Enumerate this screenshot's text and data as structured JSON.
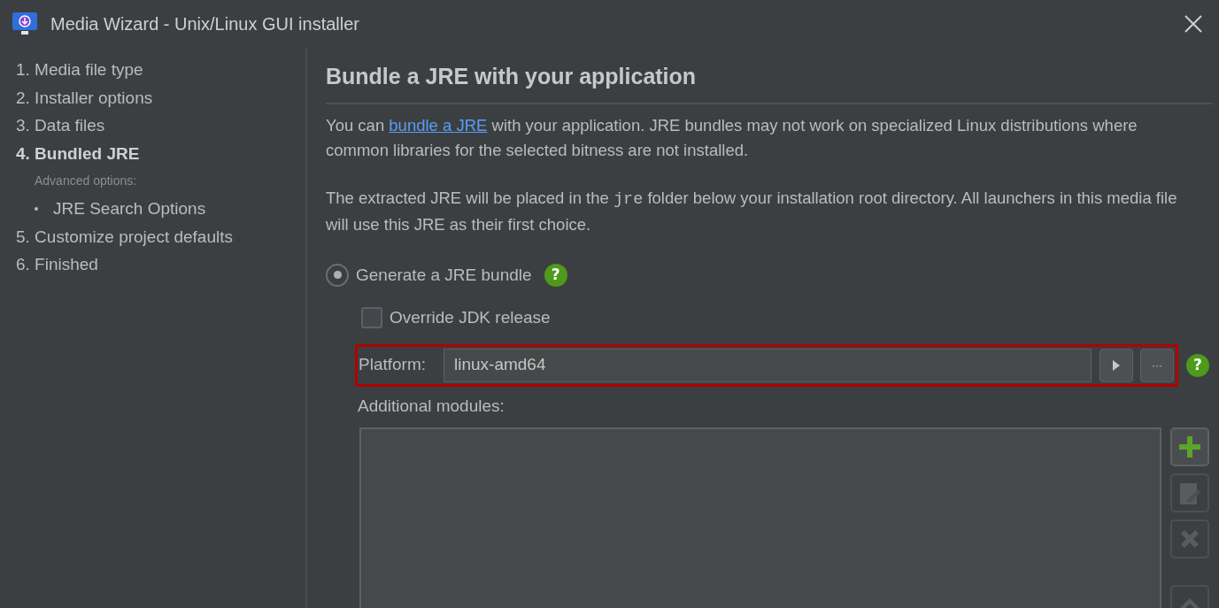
{
  "window": {
    "title": "Media Wizard - Unix/Linux GUI installer"
  },
  "steps": [
    {
      "label": "1. Media file type",
      "selected": false
    },
    {
      "label": "2. Installer options",
      "selected": false
    },
    {
      "label": "3. Data files",
      "selected": false
    },
    {
      "label": "4. Bundled JRE",
      "selected": true,
      "section_label": "Advanced options:",
      "children": [
        {
          "label": "JRE Search Options",
          "selected": false
        }
      ]
    },
    {
      "label": "5. Customize project defaults",
      "selected": false
    },
    {
      "label": "6. Finished",
      "selected": false
    }
  ],
  "heading": "Bundle a JRE with your application",
  "paragraphs": [
    [
      {
        "kind": "text",
        "text": "You can "
      },
      {
        "kind": "link",
        "text": "bundle a JRE"
      },
      {
        "kind": "text",
        "text": " with your application. JRE bundles may not work on specialized Linux distributions where common libraries for the selected bitness are not installed."
      }
    ],
    [
      {
        "kind": "text",
        "text": "The extracted JRE will be placed in the "
      },
      {
        "kind": "code",
        "text": "jre"
      },
      {
        "kind": "text",
        "text": " folder below your installation root directory. All launchers in this media file will use this JRE as their first choice."
      }
    ]
  ],
  "generate_option": {
    "label": "Generate a JRE bundle",
    "selected": true,
    "help": "?"
  },
  "override_checkbox": {
    "label": "Override JDK release",
    "checked": false
  },
  "platform": {
    "label": "Platform:",
    "value": "linux-amd64",
    "more_button": "···",
    "help": "?"
  },
  "modules": {
    "label": "Additional modules:",
    "buttons": [
      {
        "kind": "add",
        "disabled": false
      },
      {
        "kind": "edit",
        "disabled": true
      },
      {
        "kind": "delete",
        "disabled": true
      },
      {
        "kind": "up",
        "disabled": true
      }
    ]
  }
}
